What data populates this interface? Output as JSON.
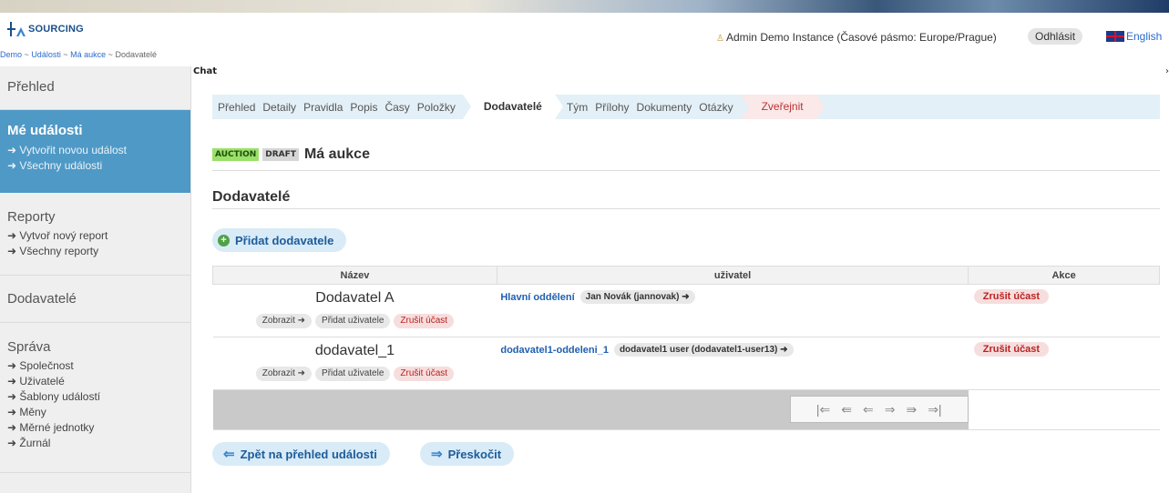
{
  "header": {
    "logo_text": "SOURCING",
    "user_info": "Admin Demo Instance (Časové pásmo: Europe/Prague)",
    "logout_label": "Odhlásit",
    "language_label": "English"
  },
  "breadcrumb": {
    "items": [
      "Demo",
      "Události",
      "Má aukce"
    ],
    "current": "Dodavatelé",
    "separator": "~"
  },
  "sidebar": {
    "overview": "Přehled",
    "events": {
      "title": "Mé události",
      "links": [
        "Vytvořit novou událost",
        "Všechny události"
      ]
    },
    "reports": {
      "title": "Reporty",
      "links": [
        "Vytvoř nový report",
        "Všechny reporty"
      ]
    },
    "suppliers": "Dodavatelé",
    "admin": {
      "title": "Správa",
      "links": [
        "Společnost",
        "Uživatelé",
        "Šablony událostí",
        "Měny",
        "Měrné jednotky",
        "Žurnál"
      ]
    }
  },
  "chat": {
    "label": "Chat",
    "arrow": "›"
  },
  "tabs": [
    "Přehled",
    "Detaily",
    "Pravidla",
    "Popis",
    "Časy",
    "Položky",
    "Dodavatelé",
    "Tým",
    "Přílohy",
    "Dokumenty",
    "Otázky",
    "Zveřejnit"
  ],
  "event": {
    "badge_type": "AUCTION",
    "badge_status": "DRAFT",
    "title": "Má aukce"
  },
  "section_title": "Dodavatelé",
  "add_supplier_label": "Přidat dodavatele",
  "table": {
    "headers": [
      "Název",
      "uživatel",
      "Akce"
    ],
    "rows": [
      {
        "name": "Dodavatel A",
        "actions": [
          "Zobrazit",
          "Přidat uživatele",
          "Zrušit účast"
        ],
        "department": "Hlavní oddělení",
        "user": "Jan Novák (jannovak)",
        "akce": "Zrušit účast"
      },
      {
        "name": "dodavatel_1",
        "actions": [
          "Zobrazit",
          "Přidat uživatele",
          "Zrušit účast"
        ],
        "department": "dodavatel1-oddeleni_1",
        "user": "dodavatel1 user (dodavatel1-user13)",
        "akce": "Zrušit účast"
      }
    ]
  },
  "pager_icons": [
    "first-page-icon",
    "fast-back-icon",
    "prev-page-icon",
    "next-page-icon",
    "fast-forward-icon",
    "last-page-icon"
  ],
  "footer_buttons": {
    "back_label": "Zpět na přehled události",
    "skip_label": "Přeskočit"
  }
}
